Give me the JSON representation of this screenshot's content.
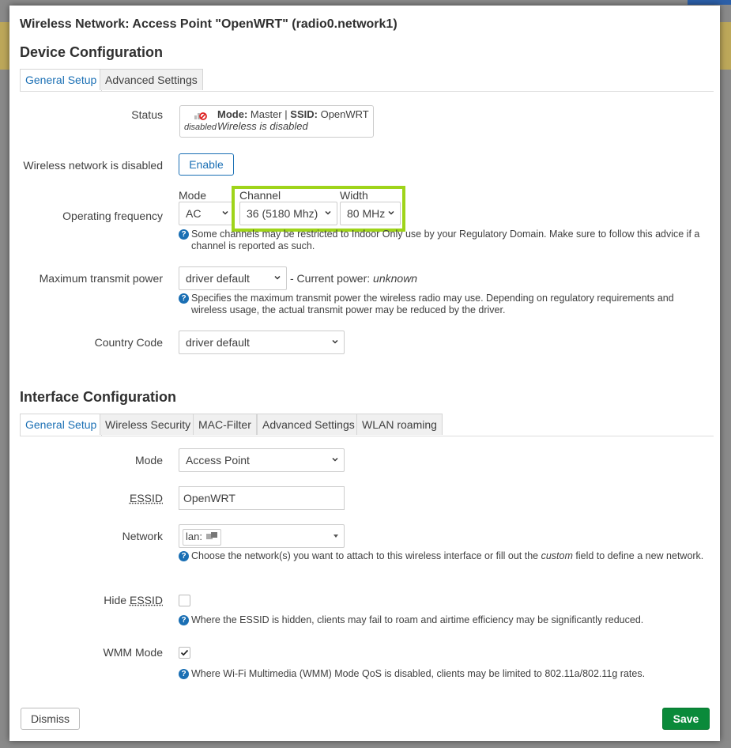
{
  "title": "Wireless Network: Access Point \"OpenWRT\" (radio0.network1)",
  "device_config": {
    "heading": "Device Configuration",
    "tabs": [
      "General Setup",
      "Advanced Settings"
    ],
    "status": {
      "label": "Status",
      "icon_caption": "disabled",
      "mode_label": "Mode:",
      "mode_value": "Master",
      "separator": "|",
      "ssid_label": "SSID:",
      "ssid_value": "OpenWRT",
      "state_text": "Wireless is disabled"
    },
    "wireless_disabled": {
      "label": "Wireless network is disabled",
      "button": "Enable"
    },
    "operating_frequency": {
      "label": "Operating frequency",
      "mode_caption": "Mode",
      "mode_value": "AC",
      "channel_caption": "Channel",
      "channel_value": "36 (5180 Mhz)",
      "width_caption": "Width",
      "width_value": "80 MHz",
      "help": "Some channels may be restricted to Indoor Only use by your Regulatory Domain. Make sure to follow this advice if a channel is reported as such."
    },
    "tx_power": {
      "label": "Maximum transmit power",
      "value": "driver default",
      "current_prefix": "- Current power:",
      "current_value": "unknown",
      "help": "Specifies the maximum transmit power the wireless radio may use. Depending on regulatory requirements and wireless usage, the actual transmit power may be reduced by the driver."
    },
    "country_code": {
      "label": "Country Code",
      "value": "driver default"
    }
  },
  "interface_config": {
    "heading": "Interface Configuration",
    "tabs": [
      "General Setup",
      "Wireless Security",
      "MAC-Filter",
      "Advanced Settings",
      "WLAN roaming"
    ],
    "mode": {
      "label": "Mode",
      "value": "Access Point"
    },
    "essid": {
      "label": "ESSID",
      "value": "OpenWRT"
    },
    "network": {
      "label": "Network",
      "value": "lan:",
      "help_prefix": "Choose the network(s) you want to attach to this wireless interface or fill out the",
      "help_em": "custom",
      "help_suffix": "field to define a new network."
    },
    "hide_essid": {
      "label_prefix": "Hide",
      "label_abbr": "ESSID",
      "checked": false,
      "help": "Where the ESSID is hidden, clients may fail to roam and airtime efficiency may be significantly reduced."
    },
    "wmm_mode": {
      "label": "WMM Mode",
      "checked": true,
      "help": "Where Wi-Fi Multimedia (WMM) Mode QoS is disabled, clients may be limited to 802.11a/802.11g rates."
    }
  },
  "footer": {
    "dismiss": "Dismiss",
    "save": "Save"
  },
  "colors": {
    "accent": "#1a6fb4",
    "save": "#0a8a3a",
    "highlight": "#9fd41a"
  }
}
